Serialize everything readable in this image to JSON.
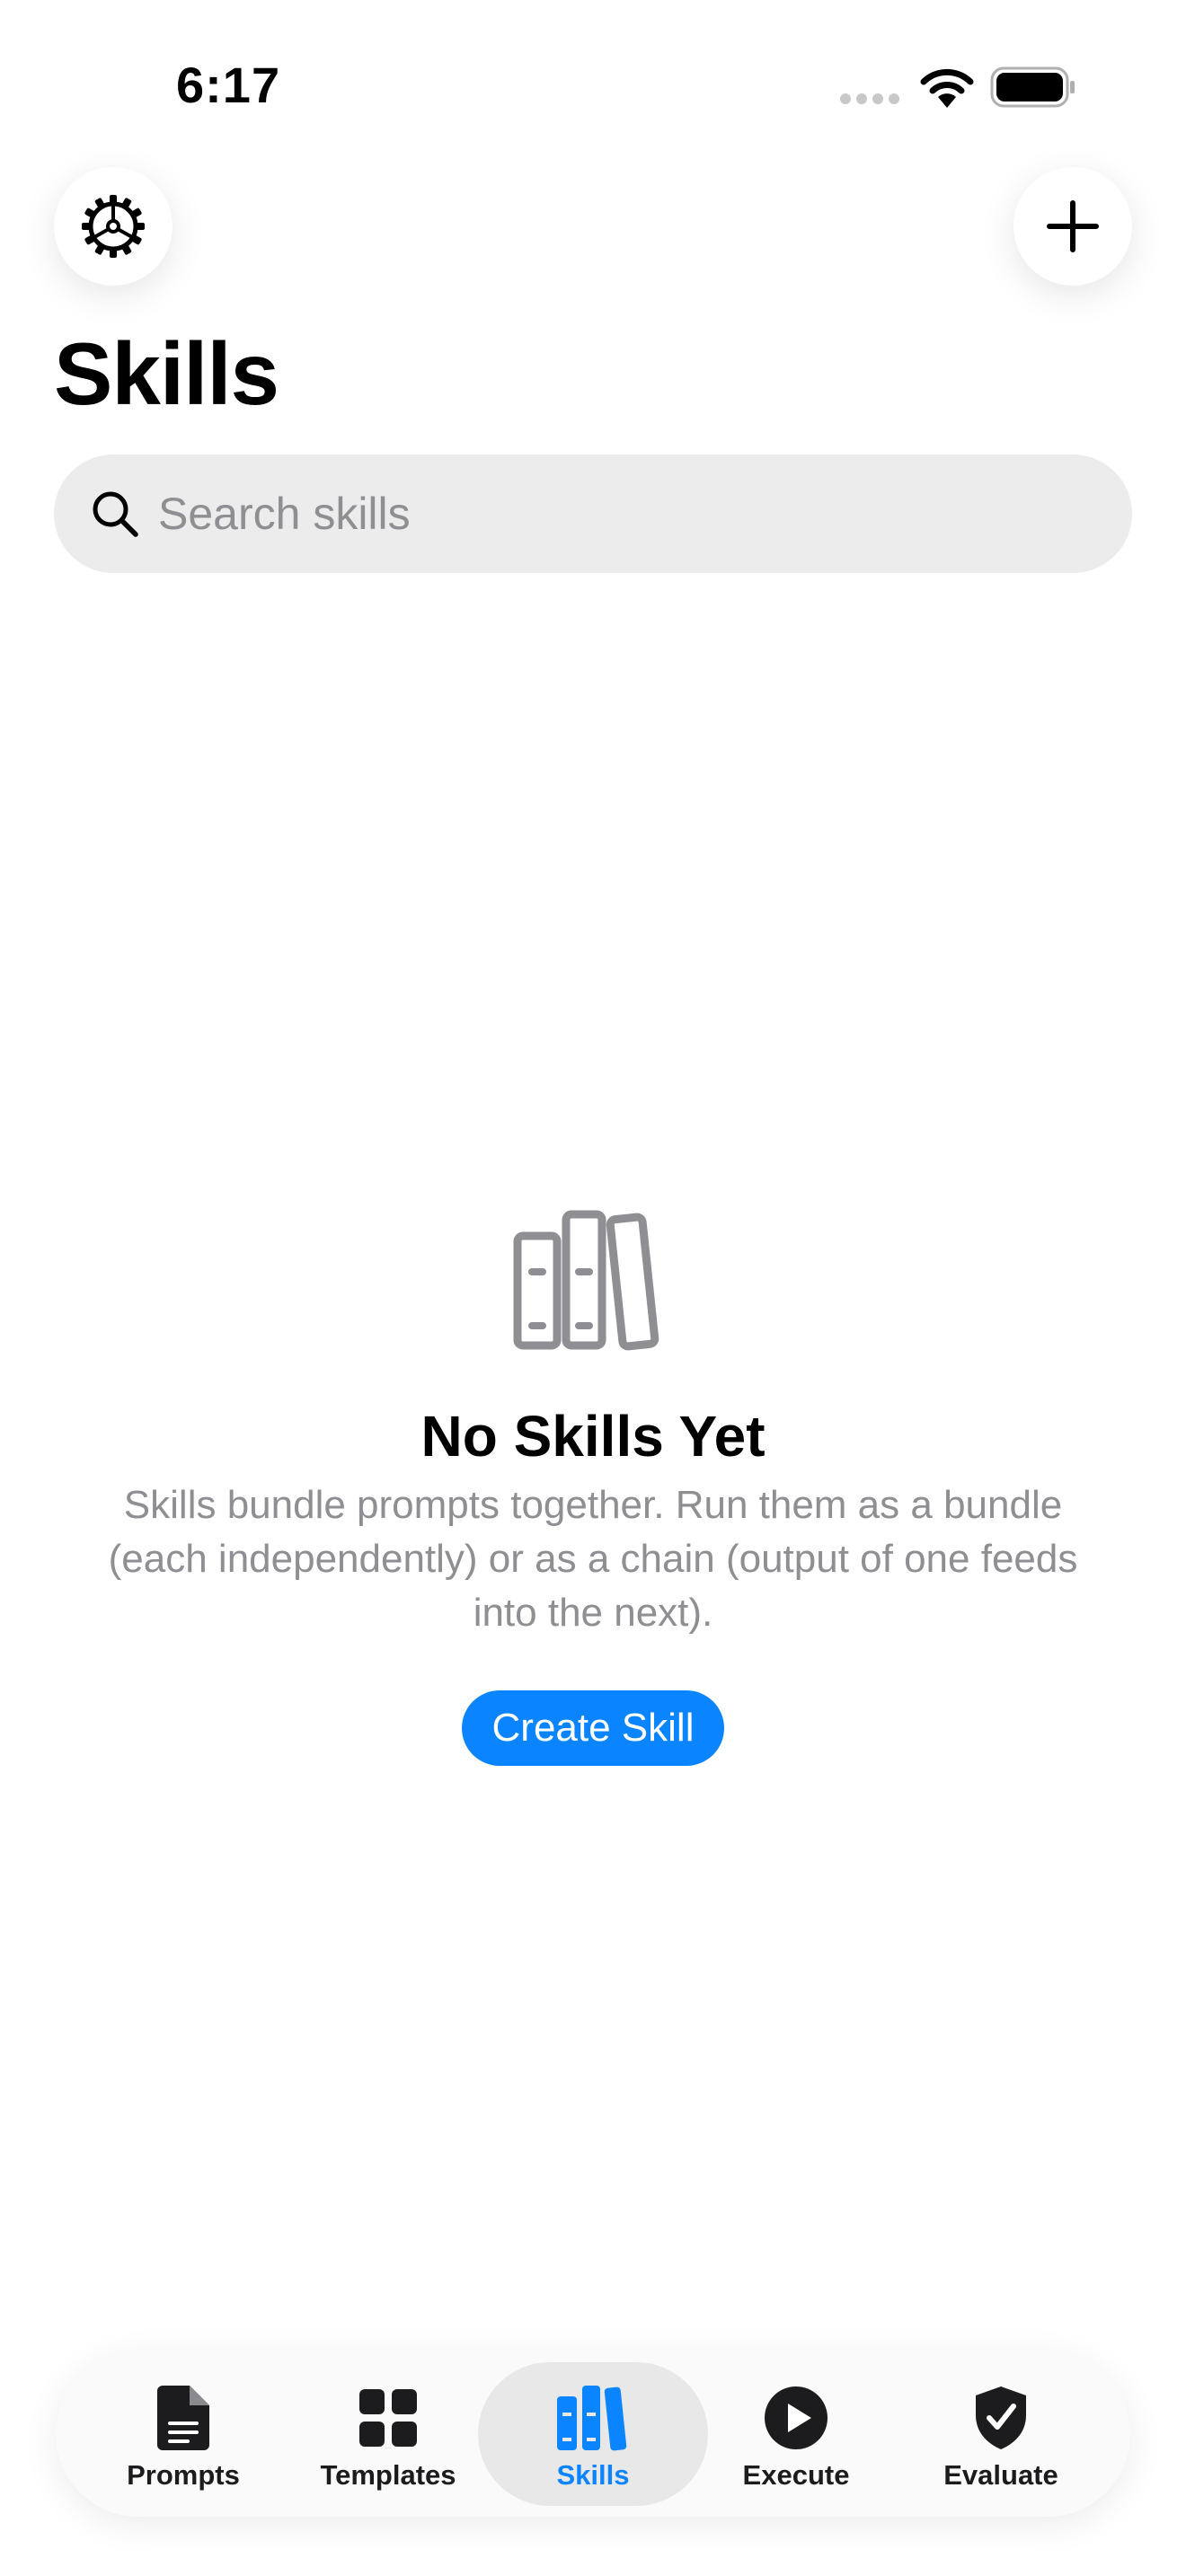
{
  "status_bar": {
    "time": "6:17"
  },
  "header": {
    "title": "Skills"
  },
  "search": {
    "placeholder": "Search skills",
    "value": ""
  },
  "empty_state": {
    "title": "No Skills Yet",
    "description": "Skills bundle prompts together. Run them as a bundle (each independently) or as a chain (output of one feeds into the next).",
    "button_label": "Create Skill"
  },
  "tab_bar": {
    "tabs": [
      {
        "label": "Prompts",
        "icon": "document-icon",
        "active": false
      },
      {
        "label": "Templates",
        "icon": "grid-icon",
        "active": false
      },
      {
        "label": "Skills",
        "icon": "books-icon",
        "active": true
      },
      {
        "label": "Execute",
        "icon": "play-circle-icon",
        "active": false
      },
      {
        "label": "Evaluate",
        "icon": "checkmark-shield-icon",
        "active": false
      }
    ]
  },
  "colors": {
    "accent": "#0a84ff",
    "secondary_text": "#8e8e93",
    "search_bg": "#ececec"
  }
}
